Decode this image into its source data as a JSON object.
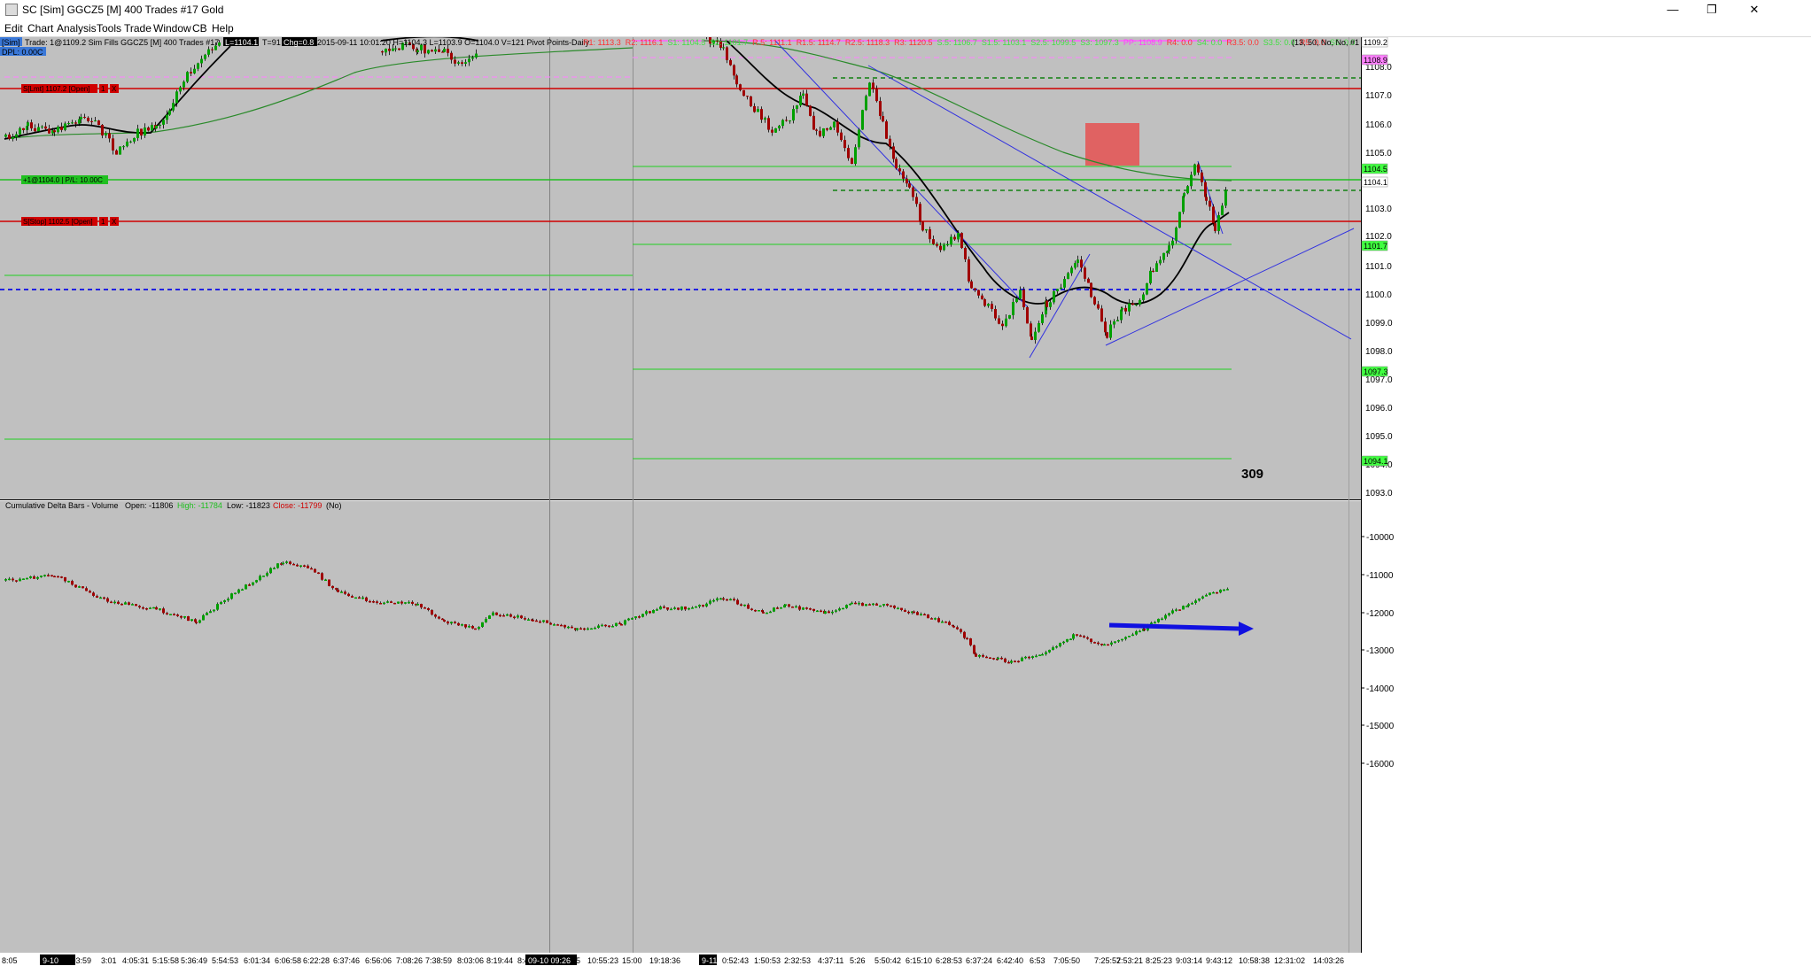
{
  "window": {
    "title": "SC [Sim] GGCZ5 [M]  400 Trades  #17  Gold",
    "minimize_glyph": "—",
    "maximize_glyph": "❐",
    "close_glyph": "✕"
  },
  "menu": [
    "Edit",
    "Chart",
    "Analysis",
    "Tools",
    "Trade",
    "Window",
    "CB",
    "Help"
  ],
  "header": {
    "sim_tag": "[Sim]",
    "trade_info": "Trade: 1@1109.2 Sim Fills  GGCZ5 [M]  400 Trades  #17",
    "last_box": "L=1104.1",
    "t_info": "T=91",
    "chg_box": "Chg=0.8",
    "ohlc": "2015-09-11 10:01:20  H=1104.3  L=1103.9  O=1104.0  V=121  Pivot Points-Daily",
    "dpl": "DPL: 0.00C",
    "right_info": "(13, 50, No, No, #1"
  },
  "pivots": [
    {
      "text": "R1: 1113.3",
      "color": "#ff3030"
    },
    {
      "text": "R2: 1116.1",
      "color": "#ff3030"
    },
    {
      "text": "S1: 1104.5",
      "color": "#40e040"
    },
    {
      "text": "S2: 1101.7",
      "color": "#40e040"
    },
    {
      "text": "R.5: 1111.1",
      "color": "#ff3030"
    },
    {
      "text": "R1.5: 1114.7",
      "color": "#ff3030"
    },
    {
      "text": "R2.5: 1118.3",
      "color": "#ff3030"
    },
    {
      "text": "R3: 1120.5",
      "color": "#ff3030"
    },
    {
      "text": "S.5: 1106.7",
      "color": "#40e040"
    },
    {
      "text": "S1.5: 1103.1",
      "color": "#40e040"
    },
    {
      "text": "S2.5: 1099.5",
      "color": "#40e040"
    },
    {
      "text": "S3: 1097.3",
      "color": "#40e040"
    },
    {
      "text": "PP: 1108.9",
      "color": "#ff40ff"
    },
    {
      "text": "R4: 0.0",
      "color": "#ff3030"
    },
    {
      "text": "S4: 0.0",
      "color": "#40e040"
    },
    {
      "text": "R3.5: 0.0",
      "color": "#ff3030"
    },
    {
      "text": "S3.5: 0.0",
      "color": "#40e040"
    },
    {
      "text": "R5: 0.0",
      "color": "#ff3030"
    },
    {
      "text": "S5: 0.0",
      "color": "#40e040"
    }
  ],
  "orders": {
    "target_label": "S[Lmt] 1107.2 [Open]",
    "position_label": "+1@1104.0 | P/L: 10.00C",
    "stop_label": "S[Stop] 1102.5 [Open]",
    "order_btn_1": "1",
    "order_btn_x": "X"
  },
  "price_axis": {
    "labels": [
      "1108.0",
      "1107.0",
      "1106.0",
      "1105.0",
      "1103.0",
      "1102.0",
      "1101.0",
      "1100.0",
      "1099.0",
      "1098.0",
      "1097.0",
      "1096.0",
      "1095.0",
      "1094.0",
      "1093.0"
    ],
    "tags": [
      {
        "text": "1109.2",
        "bg": "#ffffff",
        "fg": "#000000"
      },
      {
        "text": "1108.9",
        "bg": "#ff80ff",
        "fg": "#000000"
      },
      {
        "text": "1104.5",
        "bg": "#40ff40",
        "fg": "#000000"
      },
      {
        "text": "1104.1",
        "bg": "#ffffff",
        "fg": "#000000"
      },
      {
        "text": "1101.7",
        "bg": "#40ff40",
        "fg": "#000000"
      },
      {
        "text": "1097.3",
        "bg": "#40ff40",
        "fg": "#000000"
      },
      {
        "text": "1094.1",
        "bg": "#40ff40",
        "fg": "#000000"
      }
    ]
  },
  "annotation_count": "309",
  "lower_panel": {
    "title": "Cumulative Delta Bars - Volume",
    "open": "Open: -11806",
    "high": "High: -11784",
    "low": "Low: -11823",
    "close": "Close: -11799",
    "no": "(No)",
    "axis": [
      "-10000",
      "-11000",
      "-12000",
      "-13000",
      "-14000",
      "-15000",
      "-16000"
    ]
  },
  "time_axis": {
    "labels": [
      "8:05",
      "9-10",
      "1:03:59",
      "3:01",
      "4:05:31",
      "5:15:58",
      "5:36:49",
      "5:54:53",
      "6:01:34",
      "6:06:58",
      "6:22:28",
      "6:37:46",
      "6:56:06",
      "7:08:26",
      "7:38:59",
      "8:03:06",
      "8:19:44",
      "8:40:43",
      "09-10  09:26",
      "5",
      "10:55:23",
      "15:00",
      "19:18:36",
      "9-11",
      "0:52:43",
      "1:50:53",
      "2:32:53",
      "4:37:11",
      "5:26",
      "5:50:42",
      "6:15:10",
      "6:28:53",
      "6:37:24",
      "6:42:40",
      "6:53",
      "7:05:50",
      "7:25:52",
      "7:53:21",
      "8:25:23",
      "9:03:14",
      "9:43:12",
      "10:58:38",
      "12:31:02",
      "14:03:26"
    ]
  },
  "colors": {
    "chart_bg": "#c0c0c0",
    "up_candle": "#00a000",
    "down_candle": "#a00000",
    "ma_fast": "#000000",
    "ma_slow": "#2a8a2a",
    "target_line": "#d00000",
    "position_line": "#20c020",
    "trendline": "#3030e0",
    "pivot_pp": "#ff60ff",
    "zone": "#e06060",
    "arrow": "#1010e0"
  }
}
